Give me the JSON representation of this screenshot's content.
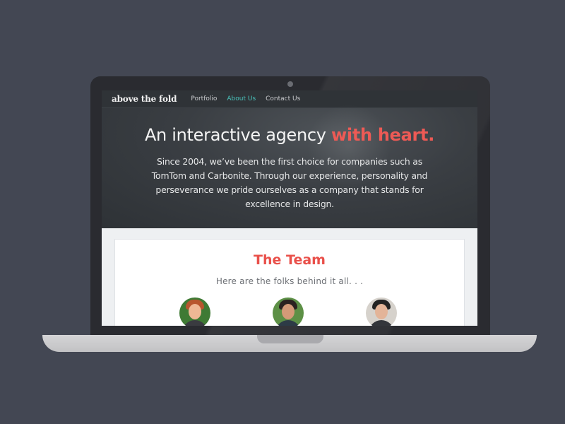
{
  "nav": {
    "brand": "above the fold",
    "items": [
      {
        "label": "Portfolio"
      },
      {
        "label": "About Us"
      },
      {
        "label": "Contact Us"
      }
    ],
    "active_color": "#4ac4bc"
  },
  "hero": {
    "headline_start": "An interactive agency ",
    "headline_accent": "with heart.",
    "body": "Since 2004, we’ve been the first choice for companies such as TomTom and Carbonite. Through our experience, personality and perseverance we pride ourselves as a company that stands for excellence in design.",
    "accent_color": "#ee5a55"
  },
  "team": {
    "title": "The Team",
    "subtitle": "Here are the folks behind it all. . ."
  }
}
